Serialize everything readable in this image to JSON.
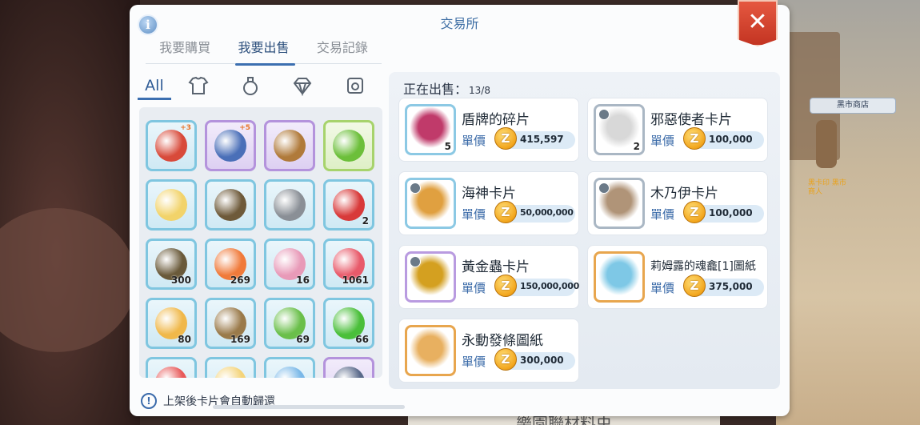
{
  "dialog": {
    "title": "交易所",
    "tabs": [
      {
        "label": "我要購買",
        "active": false
      },
      {
        "label": "我要出售",
        "active": true
      },
      {
        "label": "交易記錄",
        "active": false
      }
    ],
    "info_glyph": "i",
    "close_glyph": "✕"
  },
  "categories": {
    "all_label": "All",
    "icons": [
      "armor-icon",
      "potion-icon",
      "gem-icon",
      "card-icon"
    ]
  },
  "inventory": [
    {
      "icon": "red-axe-icon",
      "frame": "blue",
      "plus": "+3",
      "qty": ""
    },
    {
      "icon": "blue-sword-icon",
      "frame": "purple",
      "plus": "+5",
      "qty": ""
    },
    {
      "icon": "belt-icon",
      "frame": "purple",
      "plus": "",
      "qty": ""
    },
    {
      "icon": "green-pendant-icon",
      "frame": "green",
      "plus": "",
      "qty": ""
    },
    {
      "icon": "flower-icon",
      "frame": "blue",
      "plus": "",
      "qty": ""
    },
    {
      "icon": "boots-icon",
      "frame": "blue",
      "plus": "",
      "qty": ""
    },
    {
      "icon": "staff-icon",
      "frame": "blue",
      "plus": "",
      "qty": ""
    },
    {
      "icon": "red-gem-icon",
      "frame": "blue",
      "plus": "",
      "qty": "2"
    },
    {
      "icon": "seed-icon",
      "frame": "blue",
      "plus": "",
      "qty": "300"
    },
    {
      "icon": "juice-icon",
      "frame": "blue",
      "plus": "",
      "qty": "269"
    },
    {
      "icon": "peach-icon",
      "frame": "blue",
      "plus": "",
      "qty": "16"
    },
    {
      "icon": "candy-icon",
      "frame": "blue",
      "plus": "",
      "qty": "1061"
    },
    {
      "icon": "squash-icon",
      "frame": "blue",
      "plus": "",
      "qty": "80"
    },
    {
      "icon": "jar-icon",
      "frame": "blue",
      "plus": "",
      "qty": "169"
    },
    {
      "icon": "bottle-icon",
      "frame": "blue",
      "plus": "",
      "qty": "69"
    },
    {
      "icon": "lightning-icon",
      "frame": "blue",
      "plus": "",
      "qty": "66"
    },
    {
      "icon": "apple-icon",
      "frame": "blue",
      "plus": "",
      "qty": ""
    },
    {
      "icon": "star-icon",
      "frame": "blue",
      "plus": "",
      "qty": ""
    },
    {
      "icon": "crystal-icon",
      "frame": "blue",
      "plus": "",
      "qty": ""
    },
    {
      "icon": "box-icon",
      "frame": "purple",
      "plus": "",
      "qty": ""
    }
  ],
  "hint": {
    "text": "上架後卡片會自動歸還"
  },
  "selling": {
    "label": "正在出售：",
    "count": "13/8",
    "price_label": "單價",
    "coin_glyph": "Z",
    "items": [
      {
        "name": "盾牌的碎片",
        "price": "415,597",
        "qty": "5",
        "frame": "blue",
        "color": "#c03a6a"
      },
      {
        "name": "邪惡使者卡片",
        "price": "100,000",
        "qty": "2",
        "frame": "grey",
        "color": "#d8d8d8"
      },
      {
        "name": "海神卡片",
        "price": "50,000,000",
        "qty": "",
        "frame": "blue",
        "color": "#e0a040"
      },
      {
        "name": "木乃伊卡片",
        "price": "100,000",
        "qty": "",
        "frame": "grey",
        "color": "#b09478"
      },
      {
        "name": "黃金蟲卡片",
        "price": "150,000,000",
        "qty": "",
        "frame": "purple",
        "color": "#d4a020"
      },
      {
        "name": "莉姆露的魂龕[1]圖紙",
        "price": "375,000",
        "qty": "",
        "frame": "gold",
        "color": "#7ec8e6"
      },
      {
        "name": "永動發條圖紙",
        "price": "300,000",
        "qty": "",
        "frame": "gold",
        "color": "#e8b060"
      }
    ]
  },
  "scene": {
    "npc_label": "黑市商店",
    "npc_sub": "黑卡印 黑市商人",
    "sign_text": "樂園聯材料虫"
  }
}
